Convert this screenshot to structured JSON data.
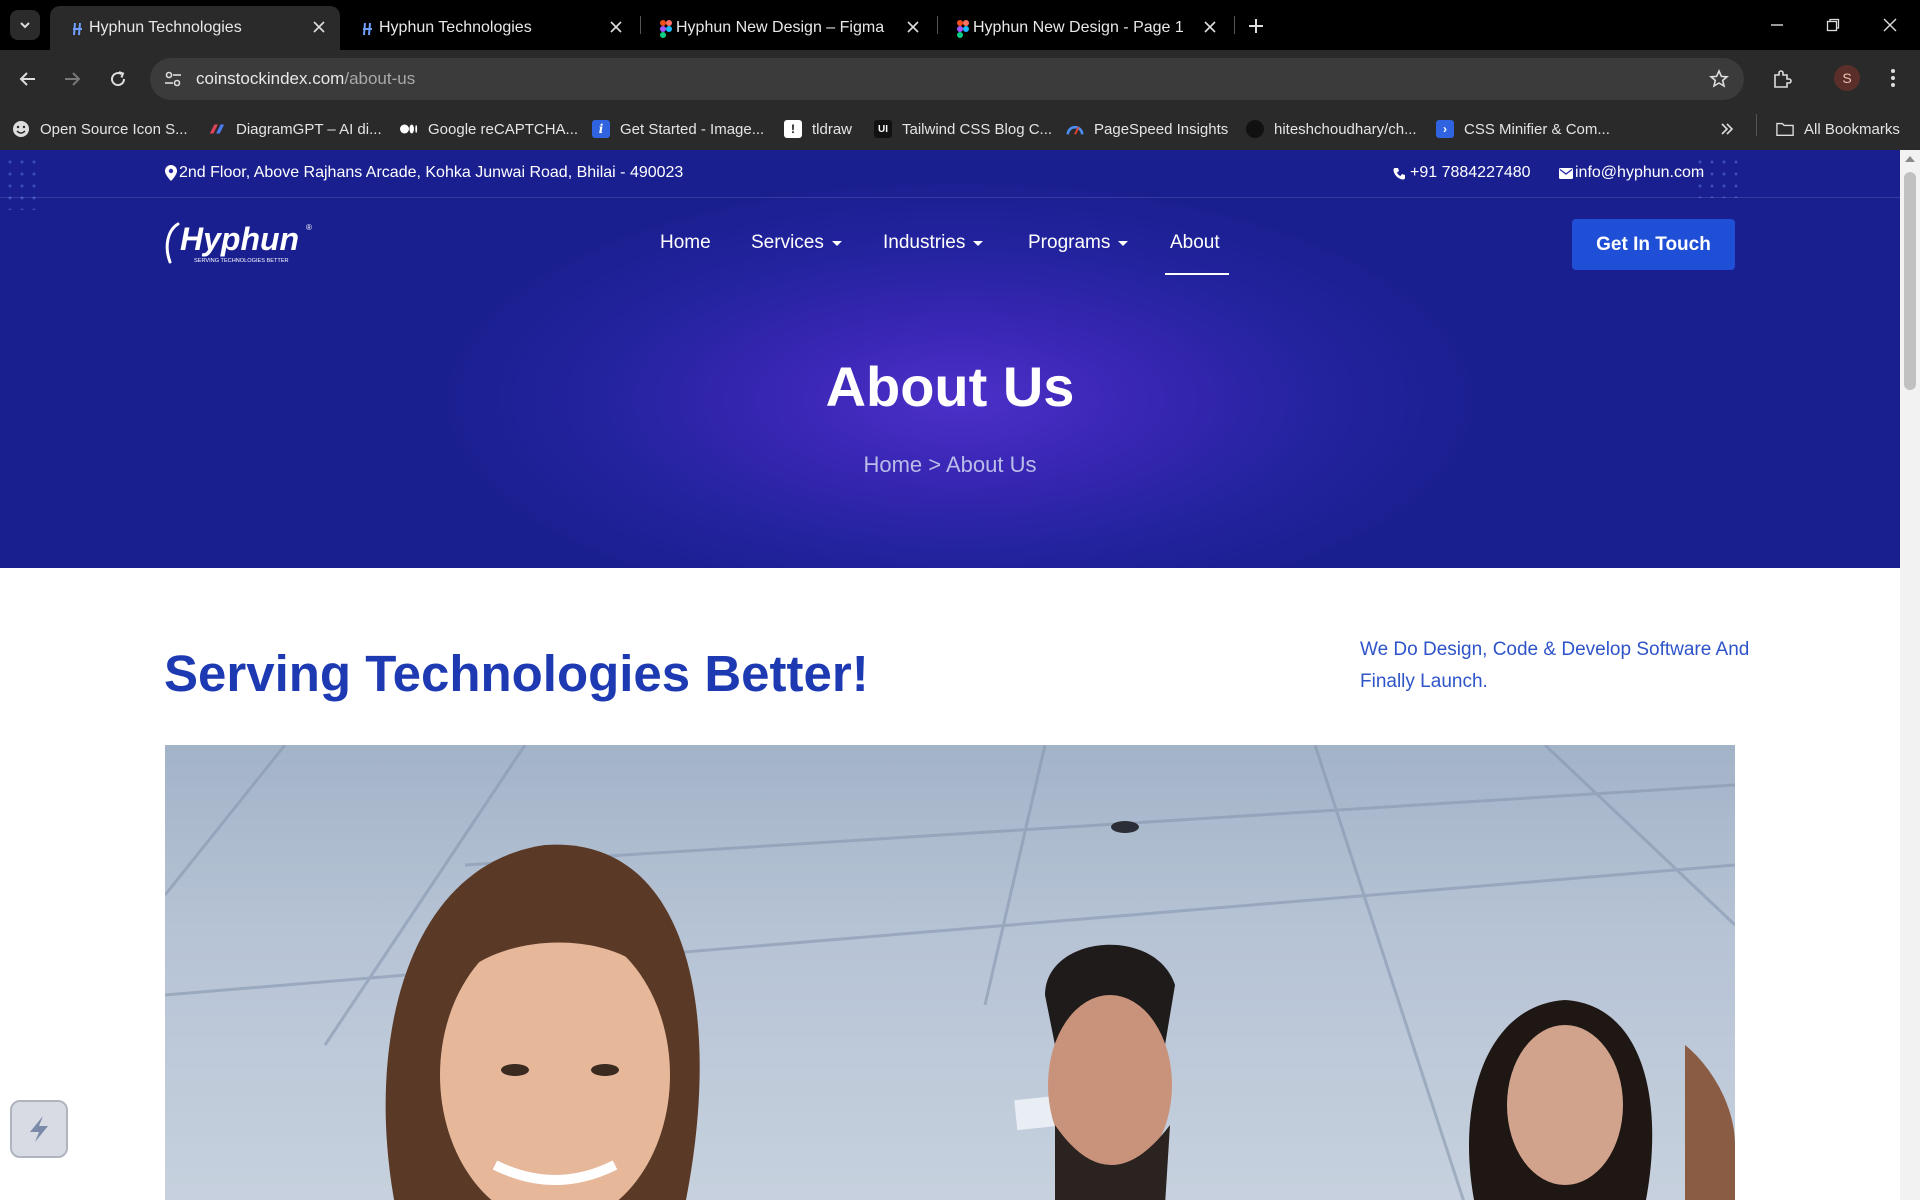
{
  "browser": {
    "tabs": [
      {
        "title": "Hyphun Technologies",
        "active": true
      },
      {
        "title": "Hyphun Technologies",
        "active": false
      },
      {
        "title": "Hyphun New Design – Figma",
        "active": false
      },
      {
        "title": "Hyphun New Design - Page 1",
        "active": false
      }
    ],
    "url_domain": "coinstockindex.com",
    "url_path": "/about-us",
    "profile_initial": "S",
    "bookmarks": [
      "Open Source Icon S...",
      "DiagramGPT – AI di...",
      "Google reCAPTCHA...",
      "Get Started - Image...",
      "tldraw",
      "Tailwind CSS Blog C...",
      "PageSpeed Insights",
      "hiteshchoudhary/ch...",
      "CSS Minifier & Com..."
    ],
    "all_bookmarks": "All Bookmarks"
  },
  "site": {
    "address": "2nd Floor, Above Rajhans Arcade, Kohka Junwai Road, Bhilai - 490023",
    "phone": "+91 7884227480",
    "email": "info@hyphun.com",
    "logo_text": "Hyphun",
    "logo_tagline": "SERVING TECHNOLOGIES BETTER",
    "nav": {
      "home": "Home",
      "services": "Services",
      "industries": "Industries",
      "programs": "Programs",
      "about": "About"
    },
    "cta": "Get In Touch",
    "hero_title": "About Us",
    "breadcrumb": "Home > About Us",
    "heading": "Serving Technologies Better!",
    "tagline": "We Do Design, Code & Develop Software And Finally Launch."
  },
  "colors": {
    "brand_blue": "#1d3ab2",
    "cta_blue": "#1f4fd6",
    "hero_purple": "#4d30c8"
  }
}
